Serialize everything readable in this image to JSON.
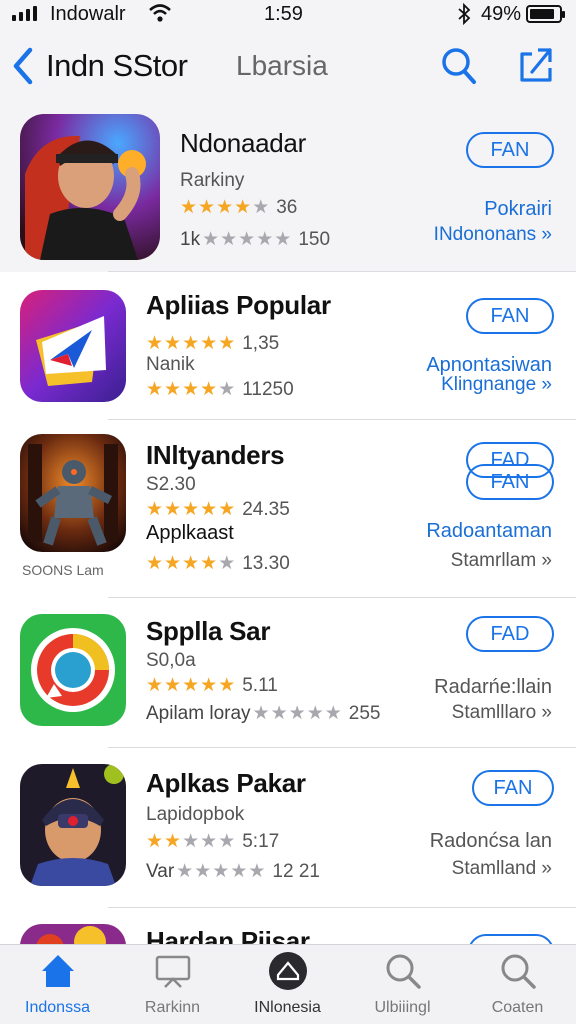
{
  "status_bar": {
    "carrier": "Indowalr",
    "time": "1:59",
    "battery": "49%"
  },
  "nav": {
    "title": "Indn SStor",
    "subtitle": "Lbarsia",
    "icons": [
      "chevron-left-icon",
      "search-icon",
      "share-icon"
    ]
  },
  "apps": [
    {
      "name": "Ndonaadar",
      "meta": "Rarkiny",
      "rating1": {
        "label": "",
        "stars": 4,
        "value": "36"
      },
      "rating2": {
        "label": "1k",
        "stars": 0,
        "value": "150"
      },
      "get": "FAN",
      "link1": "Pokrairi",
      "link2": "INdononans »"
    },
    {
      "name": "Apliias Popular",
      "meta": "",
      "rating1": {
        "label": "",
        "stars": 5,
        "value": "1,35"
      },
      "meta2": "Nanik",
      "rating2": {
        "label": "",
        "stars": 4,
        "value": "11250"
      },
      "get": "FAN",
      "link1": "Apnontasiwan",
      "link2": "Klingnange »"
    },
    {
      "name": "INltyanders",
      "meta": "S2.30",
      "rating1": {
        "label": "",
        "stars": 5,
        "value": "24.35"
      },
      "meta2": "Applkaast",
      "rating2": {
        "label": "",
        "stars": 4,
        "value": "13.30"
      },
      "caption": "SOONS Lam",
      "get": "FAD",
      "link1": "Radoantaman",
      "link2": "Stamrllam »"
    },
    {
      "name": "Spplla Sar",
      "meta": "S0,0a",
      "rating1": {
        "label": "",
        "stars": 5,
        "value": "5.11"
      },
      "rating2": {
        "label": "Apilam loray",
        "stars": 0,
        "value": "255"
      },
      "get": "FAD",
      "link1": "Radarńe:llain",
      "link2": "Stamlllaro »"
    },
    {
      "name": "Aplkas Pakar",
      "meta": "Lapidopbok",
      "rating1": {
        "label": "",
        "stars": 2,
        "value": "5:17"
      },
      "rating2": {
        "label": "Var",
        "stars": 0,
        "value": "12 21"
      },
      "get": "FAN",
      "link1": "Radonćsa lan",
      "link2": "Stamlland »"
    },
    {
      "name": "Hardan Pijsar",
      "get": "FAN"
    }
  ],
  "tabs": [
    {
      "label": "Indonssa",
      "icon": "home-icon",
      "active": true
    },
    {
      "label": "Rarkinn",
      "icon": "chart-icon",
      "active": false
    },
    {
      "label": "INlonesia",
      "icon": "apps-icon",
      "active": false
    },
    {
      "label": "Ulbiiingl",
      "icon": "search-icon",
      "active": false
    },
    {
      "label": "Coaten",
      "icon": "search-icon",
      "active": false
    }
  ],
  "colors": {
    "accent": "#1a73e8",
    "star": "#f5a623",
    "star_empty": "#a8a8ae",
    "nav_bg": "#f4f4f6"
  }
}
